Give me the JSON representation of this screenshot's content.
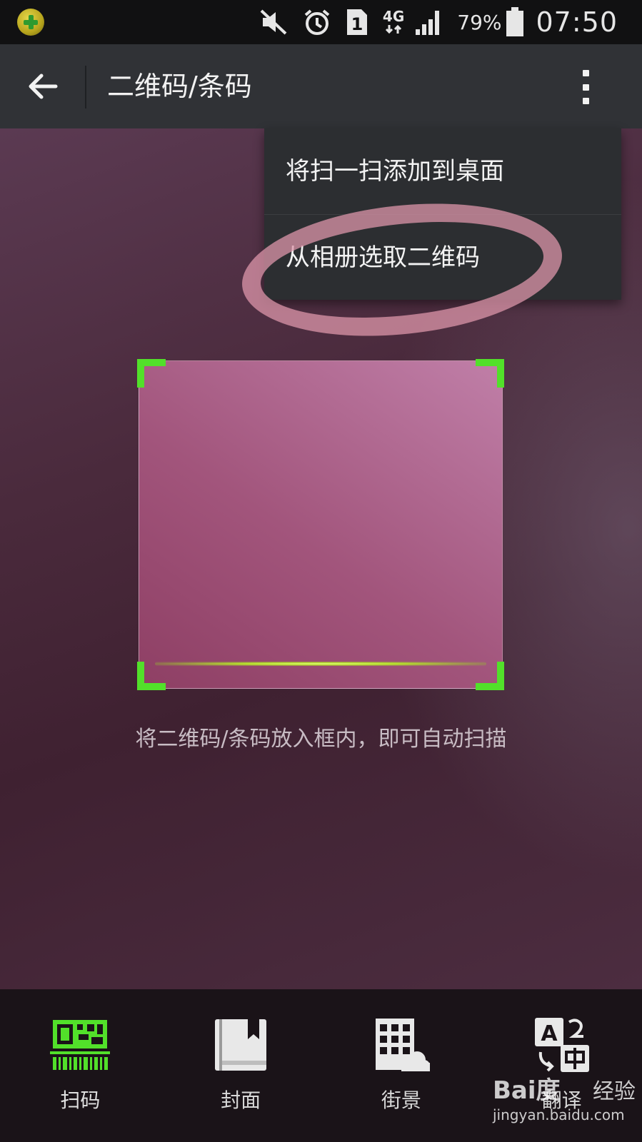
{
  "status_bar": {
    "battery_percent": "79%",
    "time": "07:50",
    "sim_slot": "1",
    "network": "4G",
    "icons": [
      "app-security-icon",
      "mute-icon",
      "alarm-icon",
      "sim-icon",
      "network-4g-icon",
      "signal-icon",
      "battery-icon"
    ]
  },
  "toolbar": {
    "title": "二维码/条码"
  },
  "menu": {
    "items": [
      {
        "label": "将扫一扫添加到桌面"
      },
      {
        "label": "从相册选取二维码"
      }
    ]
  },
  "scanner": {
    "hint": "将二维码/条码放入框内，即可自动扫描"
  },
  "bottom_nav": {
    "items": [
      {
        "label": "扫码",
        "icon": "qr-scan-icon",
        "active": true
      },
      {
        "label": "封面",
        "icon": "book-cover-icon",
        "active": false
      },
      {
        "label": "街景",
        "icon": "street-view-icon",
        "active": false
      },
      {
        "label": "翻译",
        "icon": "translate-icon",
        "active": false
      }
    ]
  },
  "watermark": {
    "logo": "Bai度",
    "sub": "经验",
    "url": "jingyan.baidu.com"
  },
  "colors": {
    "accent_green": "#52e02a",
    "toolbar_bg": "#303236",
    "menu_bg": "#2c2e31",
    "status_bg": "#111112"
  }
}
